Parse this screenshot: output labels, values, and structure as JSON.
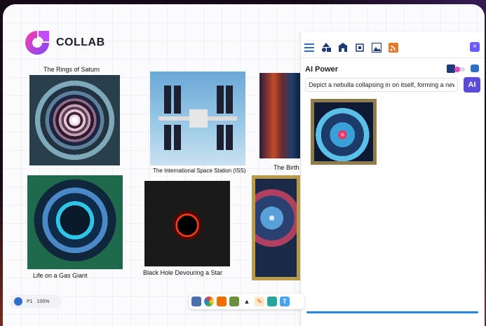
{
  "app": {
    "name": "COLLAB"
  },
  "gallery": [
    {
      "caption": "The Rings of Saturn",
      "image": "rings-of-saturn"
    },
    {
      "caption": "The International Space Station (ISS)",
      "image": "iss"
    },
    {
      "caption": "The Birth",
      "image": "birth-of-star"
    },
    {
      "caption": "Life on a Gas Giant",
      "image": "gas-giant"
    },
    {
      "caption": "Black Hole Devouring a Star",
      "image": "black-hole"
    },
    {
      "caption": "",
      "image": "nebula"
    }
  ],
  "ai_panel": {
    "title": "AI Power",
    "prompt_value": "Depict a nebulla collapsing in on itself, forming a new star",
    "ai_button_label": "AI",
    "close_label": "×",
    "result_image": "nebula-collapsing"
  },
  "status": {
    "page": "P1",
    "zoom": "100%"
  },
  "colors": {
    "accent": "#5b4bd8",
    "progress": "#1e88e5",
    "close": "#6a5cff"
  }
}
